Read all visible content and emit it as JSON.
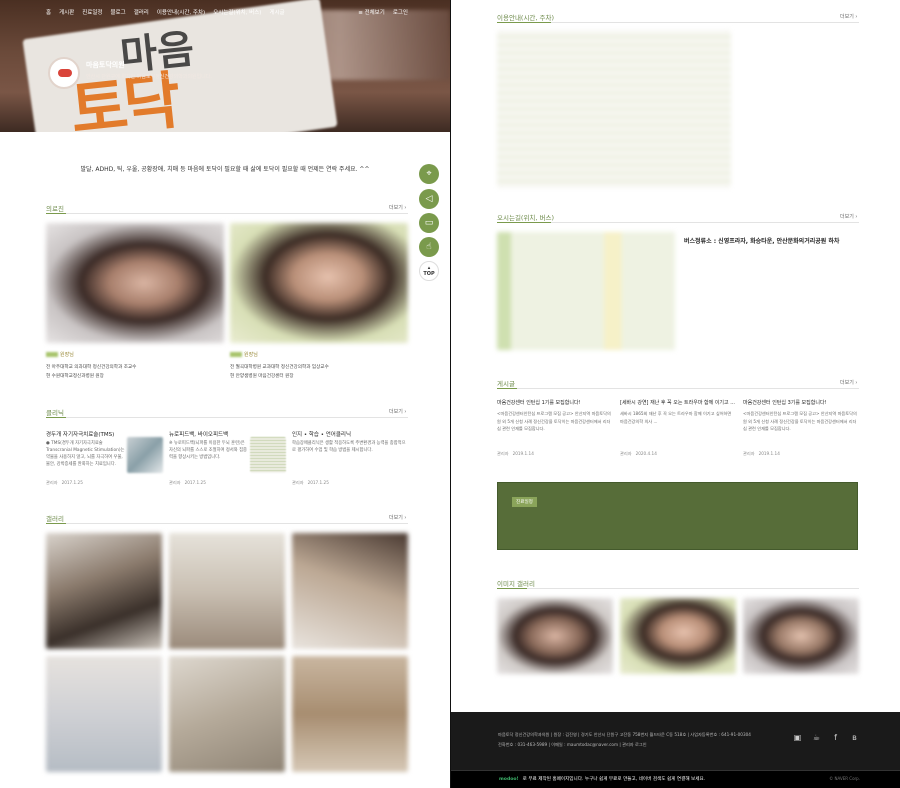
{
  "nav": {
    "items": [
      "홈",
      "게시판",
      "진료일정",
      "블로그",
      "갤러리",
      "이용안내(시간, 주차)",
      "오시는길(위치, 버스)",
      "게시글"
    ],
    "right": [
      "전체보기",
      "로그인"
    ]
  },
  "site": {
    "name": "마음토닥의원",
    "subtitle": "안산시 단원구에 위치한 마음토닥정신건강의학과의원입니다."
  },
  "intro": "발달, ADHD, 틱, 우울, 공황장애, 치매 등 마음에 토닥이 필요할 때 삶에 토닥이 필요할 때 언제든 연락 주세요. ^^",
  "more_label": "더보기",
  "doctors": {
    "title": "의료진",
    "items": [
      {
        "name": "원장님",
        "line1": "전 아주대학교 의과대학 정신건강의학과 조교수",
        "line2": "현 수원대학교정신과병원 원장"
      },
      {
        "name": "원장님",
        "line1": "전 월곡대학병원 교과대학 정신건강의학과 임상교수",
        "line2": "현 안양샘병원 마음건강센터 원장"
      }
    ]
  },
  "clinic": {
    "title": "클리닉",
    "items": [
      {
        "title": "경두개 자기자극치료술(TMS)",
        "desc": "● TMS(경두개 자기자극치료술 Transcranial Magnetic Stimulation)는 약물을 사용하지 않고, 뇌를 자극하여 우울, 불안, 강박증세를 완화하는 치료입니다.",
        "author": "관리자",
        "date": "2017.1.25"
      },
      {
        "title": "뉴로피드백, 바이오피드백",
        "desc": "※ 뉴로피드백(뇌파를 이용한 두뇌 훈련)은 자신의 뇌파를 스스로 조절하여 정서와 집중력을 향상시키는 방법입니다.",
        "author": "관리자",
        "date": "2017.1.25"
      },
      {
        "title": "인지 • 학습 • 언어클리닉",
        "desc": "학습장애클리닉은 생활 적응하도록 주변환경과 능력을 종합적으로 평가하여 수업 및 학습 방법을 제시합니다.",
        "author": "관리자",
        "date": "2017.1.25"
      }
    ]
  },
  "gallery": {
    "title": "갤러리"
  },
  "hours": {
    "title": "이용안내(시간, 주차)"
  },
  "location": {
    "title": "오시는길(위치, 버스)",
    "bus": "버스정류소 : 신영프라자, 화승타운, 안산문화의거리공원 하차"
  },
  "board": {
    "title": "게시글",
    "items": [
      {
        "title": "마음건강센터 인턴십 1기를 모집합니다!",
        "desc": "<마음건강센터인턴십 프로그램 모집 공고> 안산지역 마음토닥의원 외 5개 신청 사례 정신건강을 토닥이는 마음건강센터에서 리더십 관련 인재를 모집합니다.",
        "author": "관리자",
        "date": "2019.1.14"
      },
      {
        "title": "[세바시 강연] 재난 후 꼭 오는 트라우마 함께 이기고 ...",
        "desc": "세바시 1865회 재난 후 꼭 오는 트라우마 함께 이기고 싶어하면 마음건강의학 의사 ...",
        "author": "관리자",
        "date": "2020.4.14"
      },
      {
        "title": "마음건강센터 인턴십 3기를 모집합니다!",
        "desc": "<마음건강센터인턴십 프로그램 모집 공고> 안산지역 마음토닥의원 외 5개 신청 사례 정신건강을 토닥이는 마음건강센터에서 리더십 관련 인재를 모집합니다.",
        "author": "관리자",
        "date": "2019.1.14"
      }
    ]
  },
  "schedule_badge": "진료일정",
  "image_gallery": {
    "title": "이미지 갤러리"
  },
  "footer": {
    "line1": "마음토닥 정신건강의학과의원   |   원장 : 김진영   |   경기도 안산시 단원구 고잔동 758번지 월드타운 C동 518호   |   사업자등록번호 : 641-91-00304",
    "line2": "전화번호 : 031-463-5989   |   이메일 : maumtodac@naver.com   |   관리자 로그인"
  },
  "modoo": {
    "text": "로 무료 제작된 홈페이지입니다. 누구나 쉽게 무료로 만들고, 네이버 검색도 쉽게 연결해 보세요.",
    "brand": "modoo!",
    "copy": "© NAVER Corp."
  }
}
